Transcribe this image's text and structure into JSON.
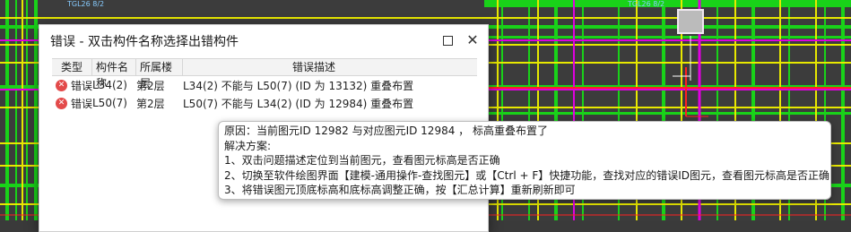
{
  "dialog": {
    "title": "错误 - 双击构件名称选择出错构件",
    "columns": {
      "type": "类型",
      "name": "构件名称",
      "floor": "所属楼层",
      "desc": "错误描述"
    },
    "rows": [
      {
        "type": "错误",
        "name": "L34(2)",
        "floor": "第2层",
        "desc": "L34(2) 不能与 L50(7) (ID 为 13132) 重叠布置"
      },
      {
        "type": "错误",
        "name": "L50(7)",
        "floor": "第2层",
        "desc": "L50(7) 不能与 L34(2) (ID 为 12984) 重叠布置"
      }
    ]
  },
  "tooltip": {
    "line1": "原因：当前图元ID 12982 与对应图元ID 12984 ， 标高重叠布置了",
    "line2": "解决方案:",
    "line3": "1、双击问题描述定位到当前图元，查看图元标高是否正确",
    "line4": "2、切换至软件绘图界面【建模-通用操作-查找图元】或【Ctrl + F】快捷功能，查找对应的错误ID图元，查看图元标高是否正确",
    "line5": "3、将错误图元顶底标高和底标高调整正确，按【汇总计算】重新刷新即可"
  },
  "cad_labels": {
    "label_a": "TGL26 8/2",
    "label_b": "TGL26 8/2"
  },
  "colors": {
    "cad_green": "#19d219",
    "cad_yellow": "#e8e800",
    "cad_magenta": "#e000e0",
    "cad_red": "#ff2020",
    "error_red": "#e34a4a"
  }
}
